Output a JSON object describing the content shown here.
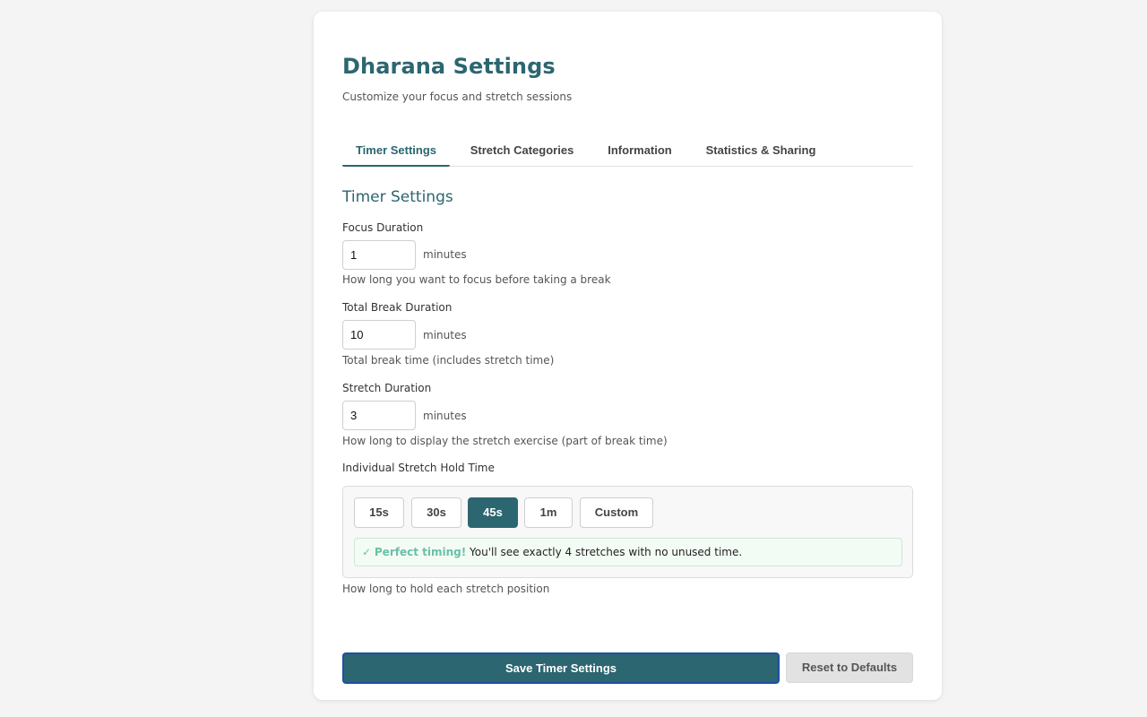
{
  "page": {
    "title": "Dharana Settings",
    "subtitle": "Customize your focus and stretch sessions"
  },
  "tabs": [
    {
      "label": "Timer Settings",
      "active": true
    },
    {
      "label": "Stretch Categories",
      "active": false
    },
    {
      "label": "Information",
      "active": false
    },
    {
      "label": "Statistics & Sharing",
      "active": false
    }
  ],
  "section": {
    "title": "Timer Settings"
  },
  "fields": {
    "focus": {
      "label": "Focus Duration",
      "value": "1",
      "unit": "minutes",
      "help": "How long you want to focus before taking a break"
    },
    "break": {
      "label": "Total Break Duration",
      "value": "10",
      "unit": "minutes",
      "help": "Total break time (includes stretch time)"
    },
    "stretch": {
      "label": "Stretch Duration",
      "value": "3",
      "unit": "minutes",
      "help": "How long to display the stretch exercise (part of break time)"
    }
  },
  "hold": {
    "label": "Individual Stretch Hold Time",
    "options": [
      {
        "label": "15s",
        "selected": false
      },
      {
        "label": "30s",
        "selected": false
      },
      {
        "label": "45s",
        "selected": true
      },
      {
        "label": "1m",
        "selected": false
      },
      {
        "label": "Custom",
        "selected": false
      }
    ],
    "note_check": "✓",
    "note_strong": "Perfect timing!",
    "note_text": "You'll see exactly 4 stretches with no unused time.",
    "help": "How long to hold each stretch position"
  },
  "actions": {
    "save_label": "Save Timer Settings",
    "reset_label": "Reset to Defaults"
  },
  "colors": {
    "accent": "#2c6670",
    "success": "#6bbfa7",
    "background": "#f4f4f4"
  }
}
